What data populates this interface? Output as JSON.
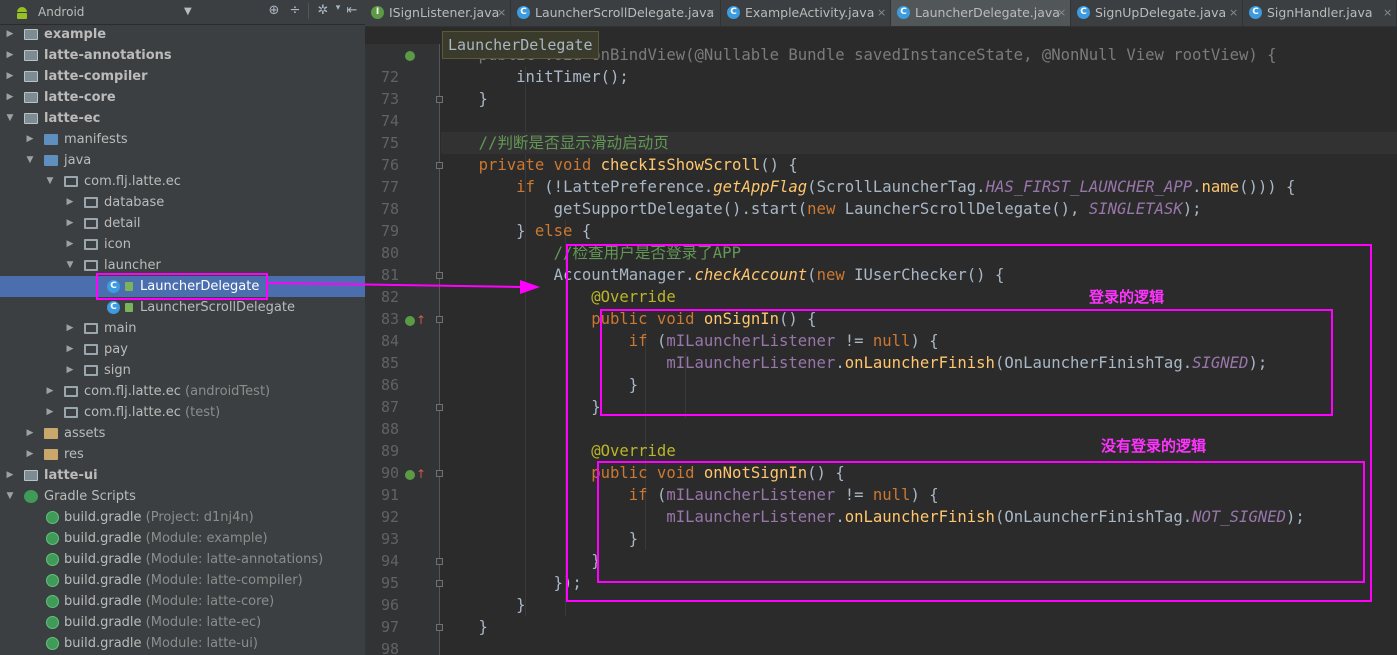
{
  "toolbar": {
    "view_mode": "Android",
    "icons": [
      "sync-icon",
      "collapse-icon",
      "gear-icon",
      "hide-icon"
    ]
  },
  "tree": {
    "example": "example",
    "latte_annotations": "latte-annotations",
    "latte_compiler": "latte-compiler",
    "latte_core": "latte-core",
    "latte_ec": "latte-ec",
    "manifests": "manifests",
    "java": "java",
    "package_main": "com.flj.latte.ec",
    "database": "database",
    "detail": "detail",
    "icon": "icon",
    "launcher": "launcher",
    "launcher_delegate": "LauncherDelegate",
    "launcher_scroll_delegate": "LauncherScrollDelegate",
    "main": "main",
    "pay": "pay",
    "sign": "sign",
    "package_android_test": "com.flj.latte.ec",
    "android_test_suffix": "(androidTest)",
    "package_test": "com.flj.latte.ec",
    "test_suffix": "(test)",
    "assets": "assets",
    "res": "res",
    "latte_ui": "latte-ui",
    "gradle_scripts": "Gradle Scripts",
    "gradle_files": [
      {
        "name": "build.gradle",
        "suffix": "(Project: d1nj4n)"
      },
      {
        "name": "build.gradle",
        "suffix": "(Module: example)"
      },
      {
        "name": "build.gradle",
        "suffix": "(Module: latte-annotations)"
      },
      {
        "name": "build.gradle",
        "suffix": "(Module: latte-compiler)"
      },
      {
        "name": "build.gradle",
        "suffix": "(Module: latte-core)"
      },
      {
        "name": "build.gradle",
        "suffix": "(Module: latte-ec)"
      },
      {
        "name": "build.gradle",
        "suffix": "(Module: latte-ui)"
      }
    ]
  },
  "tabs": [
    {
      "label": "ISignListener.java",
      "icon": "interface-icon"
    },
    {
      "label": "LauncherScrollDelegate.java",
      "icon": "class-icon"
    },
    {
      "label": "ExampleActivity.java",
      "icon": "class-icon"
    },
    {
      "label": "LauncherDelegate.java",
      "icon": "class-icon",
      "active": true
    },
    {
      "label": "SignUpDelegate.java",
      "icon": "class-icon"
    },
    {
      "label": "SignHandler.java",
      "icon": "class-icon"
    }
  ],
  "breadcrumb": "LauncherDelegate",
  "line_numbers": [
    "72",
    "73",
    "74",
    "75",
    "76",
    "77",
    "78",
    "79",
    "80",
    "81",
    "82",
    "83",
    "84",
    "85",
    "86",
    "87",
    "88",
    "89",
    "90",
    "91",
    "92",
    "93",
    "94",
    "95",
    "96",
    "97",
    "98"
  ],
  "code": {
    "l71": "    public void onBindView(@Nullable Bundle savedInstanceState, @NonNull View rootView) {",
    "l72_call": "initTimer",
    "l75_comment": "//判断是否显示滑动启动页",
    "l76_method": "checkIsShowScroll",
    "l77_class": "LattePreference",
    "l77_method": "getAppFlag",
    "l77_tag": "ScrollLauncherTag",
    "l77_const": "HAS_FIRST_LAUNCHER_APP",
    "l78_call": "getSupportDelegate",
    "l78_class": "LauncherScrollDelegate",
    "l78_const": "SINGLETASK",
    "l80_comment": "//检查用户是否登录了APP",
    "l81_class": "AccountManager",
    "l81_method": "checkAccount",
    "l81_iface": "IUserChecker",
    "override": "@Override",
    "l83_method": "onSignIn",
    "listener": "mILauncherListener",
    "finish_method": "onLauncherFinish",
    "finish_tag": "OnLauncherFinishTag",
    "signed": "SIGNED",
    "l90_method": "onNotSignIn",
    "not_signed": "NOT_SIGNED"
  },
  "annotations": {
    "signed_in_note": "登录的逻辑",
    "not_signed_in_note": "没有登录的逻辑"
  }
}
